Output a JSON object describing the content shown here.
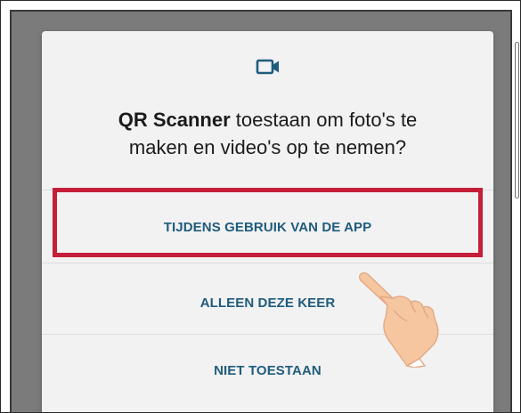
{
  "dialog": {
    "icon": "video-camera-icon",
    "title_app": "QR Scanner",
    "title_rest_line1": " toestaan om foto's te",
    "title_line2": "maken en video's op te nemen?",
    "buttons": [
      {
        "label": "TIJDENS GEBRUIK VAN DE APP"
      },
      {
        "label": "ALLEEN DEZE KEER"
      },
      {
        "label": "NIET TOESTAAN"
      }
    ]
  },
  "colors": {
    "accent": "#1f5c7d",
    "highlight": "#c51e3a",
    "scrim": "#7b7b7b",
    "dialog_bg": "#f2f2f2"
  },
  "overlay": {
    "pointer_icon": "pointing-hand-icon"
  }
}
